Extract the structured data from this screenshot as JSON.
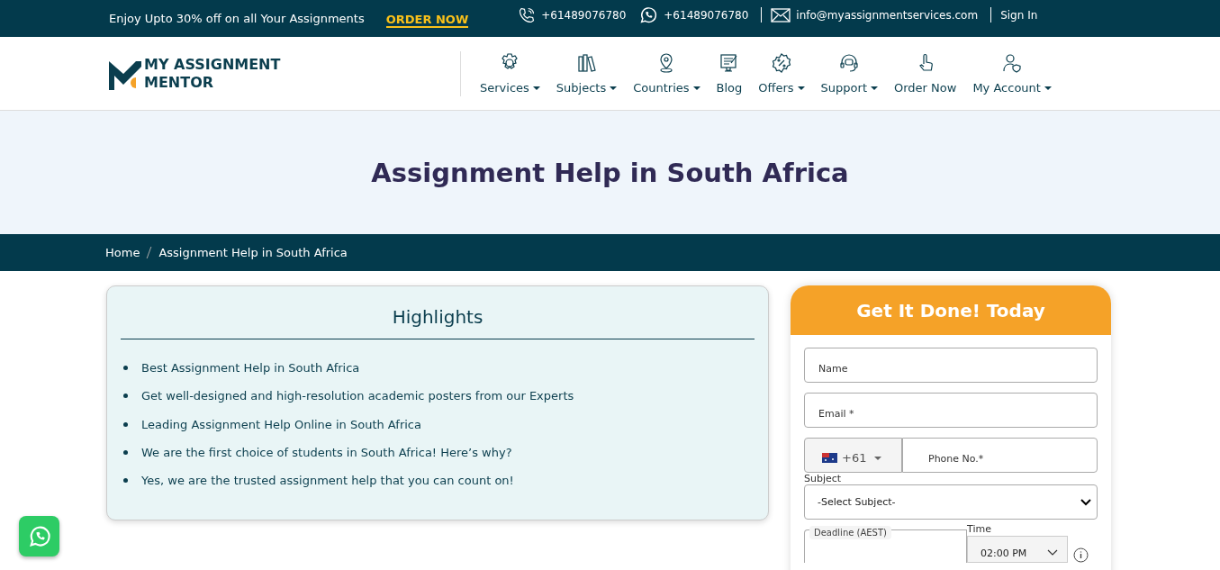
{
  "promo": {
    "text": "Enjoy Upto 30% off on all Your Assignments",
    "link": "ORDER NOW"
  },
  "contacts": [
    {
      "kind": "phone",
      "text": "+61489076780"
    },
    {
      "kind": "whatsapp",
      "text": "+61489076780"
    },
    {
      "kind": "mail",
      "text": "info@myassignmentservices.com"
    }
  ],
  "sign_in": "Sign In",
  "logo": {
    "line1": "MY ASSIGNMENT",
    "line2": "MENTOR"
  },
  "nav": [
    {
      "label": "Services",
      "dropdown": true
    },
    {
      "label": "Subjects",
      "dropdown": true
    },
    {
      "label": "Countries",
      "dropdown": true
    },
    {
      "label": "Blog",
      "dropdown": false
    },
    {
      "label": "Offers",
      "dropdown": true
    },
    {
      "label": "Support",
      "dropdown": true
    },
    {
      "label": "Order Now",
      "dropdown": false
    },
    {
      "label": "My Account",
      "dropdown": true
    }
  ],
  "hero_title": "Assignment Help in South Africa",
  "breadcrumb": [
    "Home",
    "Assignment Help in South Africa"
  ],
  "highlights": {
    "title": "Highlights",
    "items": [
      "Best Assignment Help in South Africa",
      "Get well-designed and high-resolution academic posters from our Experts",
      "Leading Assignment Help Online in South Africa",
      "We are the first choice of students in South Africa! Here’s why?",
      "Yes, we are the trusted assignment help that you can count on!"
    ]
  },
  "form": {
    "title": "Get It Done! Today",
    "name_placeholder": "Name",
    "email_placeholder": "Email *",
    "country_code": "+61",
    "phone_placeholder": "Phone No.*",
    "subject_label": "Subject",
    "subject_value": "-Select Subject-",
    "deadline_label": "Deadline (AEST)",
    "time_label": "Time",
    "time_value": "02:00 PM"
  }
}
